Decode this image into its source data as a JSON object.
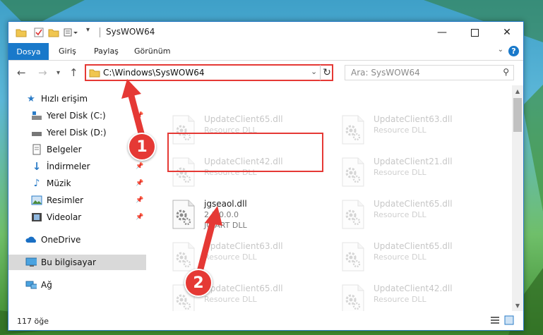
{
  "window": {
    "title": "SysWOW64"
  },
  "ribbon": {
    "file_tab": "Dosya",
    "tabs": [
      "Giriş",
      "Paylaş",
      "Görünüm"
    ]
  },
  "address": {
    "path": "C:\\Windows\\SysWOW64"
  },
  "search": {
    "placeholder": "Ara: SysWOW64"
  },
  "sidebar": {
    "items": [
      {
        "label": "Hızlı erişim",
        "icon": "star-icon"
      },
      {
        "label": "Yerel Disk (C:)",
        "icon": "drive-c-icon"
      },
      {
        "label": "Yerel Disk (D:)",
        "icon": "drive-icon"
      },
      {
        "label": "Belgeler",
        "icon": "documents-icon"
      },
      {
        "label": "İndirmeler",
        "icon": "downloads-icon"
      },
      {
        "label": "Müzik",
        "icon": "music-icon"
      },
      {
        "label": "Resimler",
        "icon": "pictures-icon"
      },
      {
        "label": "Videolar",
        "icon": "videos-icon"
      },
      {
        "label": "OneDrive",
        "icon": "onedrive-icon"
      },
      {
        "label": "Bu bilgisayar",
        "icon": "computer-icon"
      },
      {
        "label": "Ağ",
        "icon": "network-icon"
      }
    ]
  },
  "files": [
    {
      "name": "UpdateClient65.dll",
      "desc": "Resource DLL"
    },
    {
      "name": "UpdateClient63.dll",
      "desc": "Resource DLL"
    },
    {
      "name": "UpdateClient42.dll",
      "desc": "Resource DLL"
    },
    {
      "name": "UpdateClient21.dll",
      "desc": "Resource DLL"
    },
    {
      "name": "jgseaol.dll",
      "version": "2.1.0.0.0",
      "desc": "JG ART DLL"
    },
    {
      "name": "UpdateClient65.dll",
      "desc": "Resource DLL"
    },
    {
      "name": "UpdateClient63.dll",
      "desc": "Resource DLL"
    },
    {
      "name": "UpdateClient65.dll",
      "desc": "Resource DLL"
    },
    {
      "name": "UpdateClient65.dll",
      "desc": "Resource DLL"
    },
    {
      "name": "UpdateClient42.dll",
      "desc": "Resource DLL"
    }
  ],
  "status": {
    "count": "117 öğe"
  },
  "annotations": {
    "badge1": "1",
    "badge2": "2",
    "color": "#e53935"
  }
}
